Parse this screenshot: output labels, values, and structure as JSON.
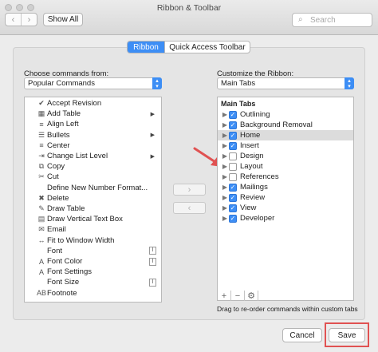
{
  "window": {
    "title": "Ribbon & Toolbar",
    "back_glyph": "‹",
    "forward_glyph": "›",
    "show_all": "Show All",
    "search_placeholder": "Search"
  },
  "tabs": {
    "ribbon": "Ribbon",
    "quick_access": "Quick Access Toolbar"
  },
  "left": {
    "label": "Choose commands from:",
    "selected": "Popular Commands",
    "items": [
      {
        "label": "Accept Revision",
        "icon": "✔",
        "submenu": false,
        "format": false
      },
      {
        "label": "Add Table",
        "icon": "▦",
        "submenu": true,
        "format": false
      },
      {
        "label": "Align Left",
        "icon": "≡",
        "submenu": false,
        "format": false
      },
      {
        "label": "Bullets",
        "icon": "☰",
        "submenu": true,
        "format": false
      },
      {
        "label": "Center",
        "icon": "≡",
        "submenu": false,
        "format": false
      },
      {
        "label": "Change List Level",
        "icon": "⇥",
        "submenu": true,
        "format": false
      },
      {
        "label": "Copy",
        "icon": "⧉",
        "submenu": false,
        "format": false
      },
      {
        "label": "Cut",
        "icon": "✂",
        "submenu": false,
        "format": false
      },
      {
        "label": "Define New Number Format...",
        "icon": "",
        "submenu": false,
        "format": false
      },
      {
        "label": "Delete",
        "icon": "✖",
        "submenu": false,
        "format": false
      },
      {
        "label": "Draw Table",
        "icon": "✎",
        "submenu": false,
        "format": false
      },
      {
        "label": "Draw Vertical Text Box",
        "icon": "▤",
        "submenu": false,
        "format": false
      },
      {
        "label": "Email",
        "icon": "✉",
        "submenu": false,
        "format": false
      },
      {
        "label": "Fit to Window Width",
        "icon": "↔",
        "submenu": false,
        "format": false
      },
      {
        "label": "Font",
        "icon": "",
        "submenu": false,
        "format": true
      },
      {
        "label": "Font Color",
        "icon": "A",
        "submenu": false,
        "format": true
      },
      {
        "label": "Font Settings",
        "icon": "A",
        "submenu": false,
        "format": false
      },
      {
        "label": "Font Size",
        "icon": "",
        "submenu": false,
        "format": true
      },
      {
        "label": "Footnote",
        "icon": "AB",
        "submenu": false,
        "format": false
      }
    ]
  },
  "middle": {
    "add_glyph": "›",
    "remove_glyph": "‹"
  },
  "right": {
    "label": "Customize the Ribbon:",
    "selected": "Main Tabs",
    "tree_header": "Main Tabs",
    "items": [
      {
        "label": "Outlining",
        "checked": true,
        "expandable": true,
        "highlight": false
      },
      {
        "label": "Background Removal",
        "checked": true,
        "expandable": true,
        "highlight": false
      },
      {
        "label": "Home",
        "checked": true,
        "expandable": true,
        "highlight": true
      },
      {
        "label": "Insert",
        "checked": true,
        "expandable": true,
        "highlight": false
      },
      {
        "label": "Design",
        "checked": false,
        "expandable": true,
        "highlight": false
      },
      {
        "label": "Layout",
        "checked": false,
        "expandable": true,
        "highlight": false
      },
      {
        "label": "References",
        "checked": false,
        "expandable": true,
        "highlight": false
      },
      {
        "label": "Mailings",
        "checked": true,
        "expandable": true,
        "highlight": false
      },
      {
        "label": "Review",
        "checked": true,
        "expandable": true,
        "highlight": false
      },
      {
        "label": "View",
        "checked": true,
        "expandable": true,
        "highlight": false
      },
      {
        "label": "Developer",
        "checked": true,
        "expandable": true,
        "highlight": false
      }
    ],
    "hint": "Drag to re-order commands within custom tabs",
    "toolbar": {
      "add": "+",
      "remove": "−",
      "gear": "⚙"
    }
  },
  "footer": {
    "cancel": "Cancel",
    "save": "Save"
  },
  "colors": {
    "accent": "#3d8ef5",
    "annotation": "#e05252"
  }
}
